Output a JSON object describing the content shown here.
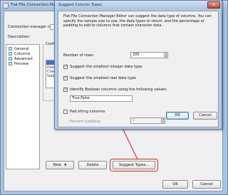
{
  "main_window": {
    "title": "Flat File Connection Manager Ed",
    "name_label": "Connection manager name",
    "description_label": "Description:",
    "nav_items": [
      "General",
      "Columns",
      "Advanced",
      "Preview"
    ],
    "group_label": "Confi",
    "column_items": [
      "Data",
      "Clien",
      "Sales"
    ],
    "buttons": {
      "new": "New",
      "delete": "Delete",
      "suggest_types": "Suggest Types...",
      "ok": "OK",
      "cancel": "Cancel"
    }
  },
  "dialog": {
    "title": "Suggest Column Types",
    "close_glyph": "x",
    "description": "Flat File Connection Manager Editor can suggest the data type of columns. You can specify the sample size to use, the data types to return, and the percentage of padding to add to columns that contain character data.",
    "rows_label": "Number of rows:",
    "rows_value": "200",
    "options": [
      {
        "label": "Suggest the smallest integer data type",
        "checked": true
      },
      {
        "label": "Suggest the smallest real data type",
        "checked": true
      },
      {
        "label": "Identify Boolean columns using the following values:",
        "checked": true
      }
    ],
    "boolean_values": "True,False",
    "pad_strings_label": "Pad string columns",
    "pad_strings_checked": false,
    "percent_padding_label": "Percent padding:",
    "percent_padding_value": "0",
    "ok_label": "OK",
    "cancel_label": "Cancel"
  },
  "annotation": {
    "highlight_color": "#d42a2a"
  }
}
